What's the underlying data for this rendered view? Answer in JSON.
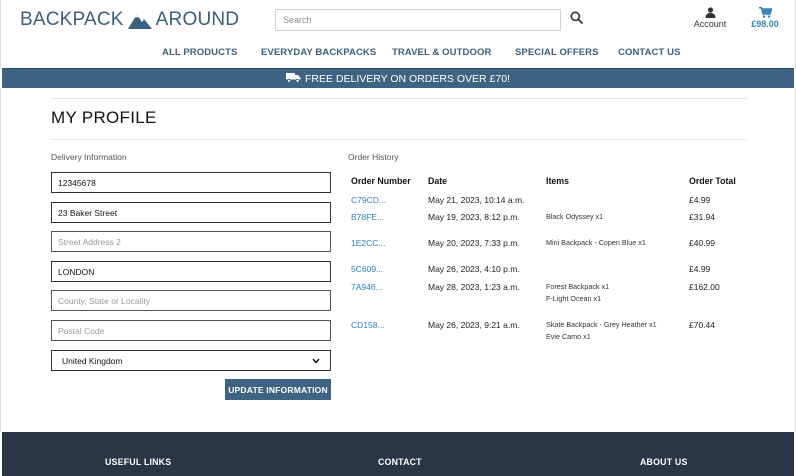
{
  "header": {
    "logo_left": "BACKPACK",
    "logo_right": "AROUND",
    "search_placeholder": "Search",
    "account_label": "Account",
    "cart_total": "£98.00"
  },
  "nav": {
    "items": [
      "ALL PRODUCTS",
      "EVERYDAY BACKPACKS",
      "TRAVEL & OUTDOOR",
      "SPECIAL OFFERS",
      "CONTACT US"
    ]
  },
  "banner": {
    "text": "FREE DELIVERY ON ORDERS OVER £70!"
  },
  "profile": {
    "title": "MY PROFILE",
    "delivery_label": "Delivery Information",
    "fields": {
      "phone": "12345678",
      "street1": "23 Baker Street",
      "street2_placeholder": "Street Address 2",
      "town": "LONDON",
      "county_placeholder": "County, State or Locality",
      "postcode_placeholder": "Postal Code",
      "country": "United Kingdom"
    },
    "update_button": "UPDATE INFORMATION"
  },
  "orders": {
    "label": "Order History",
    "headers": [
      "Order Number",
      "Date",
      "Items",
      "Order Total"
    ],
    "rows": [
      {
        "number": "C79CD...",
        "date": "May 21, 2023, 10:14 a.m.",
        "items": [
          "",
          ""
        ],
        "total": "£4.99"
      },
      {
        "number": "B78FE...",
        "date": "May 19, 2023, 8:12 p.m.",
        "items": [
          "Black Odyssey x1",
          ""
        ],
        "total": "£31.94"
      },
      {
        "number": "1E2CC...",
        "date": "May 20, 2023, 7:33 p.m.",
        "items": [
          "Mini Backpack - Copen Blue x1",
          ""
        ],
        "total": "£40.99"
      },
      {
        "number": "5C609...",
        "date": "May 26, 2023, 4:10 p.m.",
        "items": [
          "",
          ""
        ],
        "total": "£4.99"
      },
      {
        "number": "7A946...",
        "date": "May 28, 2023, 1:23 a.m.",
        "items": [
          "Forest Backpack x1",
          "F-Light Ocean x1"
        ],
        "total": "£162.00"
      },
      {
        "number": "CD158...",
        "date": "May 26, 2023, 9:21 a.m.",
        "items": [
          "Skate Backpack - Grey Heather x1",
          "Evie Camo x1"
        ],
        "total": "£70.44"
      }
    ]
  },
  "footer": {
    "useful_links": "USEFUL LINKS",
    "contact": "CONTACT",
    "about": "ABOUT US"
  },
  "colors": {
    "brand": "#3e6383",
    "link": "#2f7fc0",
    "footer": "#2a3645"
  }
}
